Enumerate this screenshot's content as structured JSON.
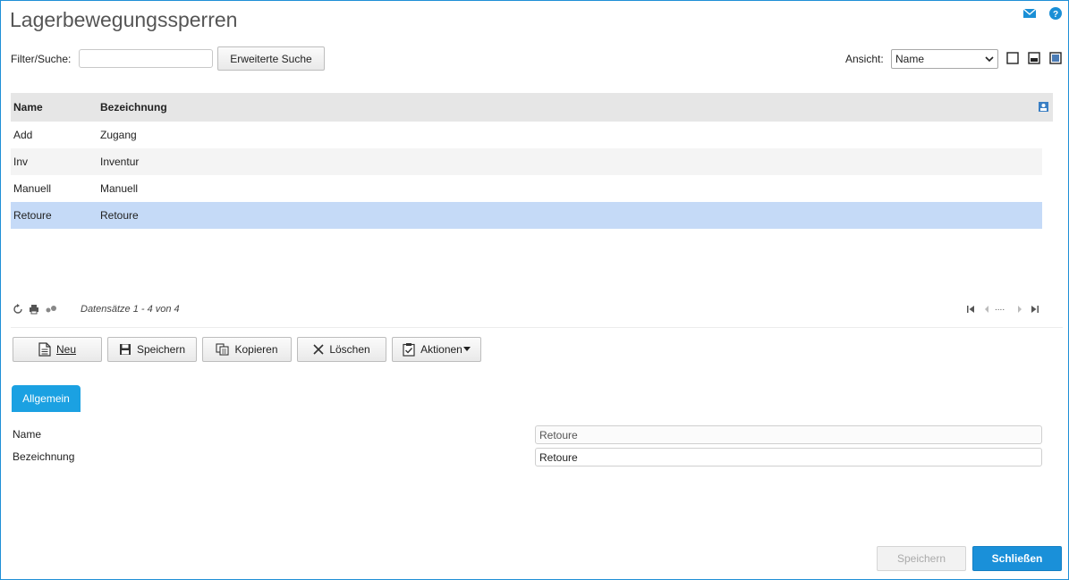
{
  "page": {
    "title": "Lagerbewegungssperren"
  },
  "filter": {
    "label": "Filter/Suche:",
    "value": "",
    "advanced_search_label": "Erweiterte Suche"
  },
  "view": {
    "label": "Ansicht:",
    "selected": "Name"
  },
  "grid": {
    "columns": [
      "Name",
      "Bezeichnung"
    ],
    "rows": [
      {
        "name": "Add",
        "desc": "Zugang"
      },
      {
        "name": "Inv",
        "desc": "Inventur"
      },
      {
        "name": "Manuell",
        "desc": "Manuell"
      },
      {
        "name": "Retoure",
        "desc": "Retoure"
      }
    ],
    "selected_index": 3,
    "record_count": "Datensätze 1 - 4 von 4",
    "pager_middle": "...."
  },
  "toolbar": {
    "new": "Neu",
    "save": "Speichern",
    "copy": "Kopieren",
    "delete": "Löschen",
    "actions": "Aktionen"
  },
  "tabs": {
    "general": "Allgemein"
  },
  "form": {
    "name_label": "Name",
    "name_value": "Retoure",
    "desc_label": "Bezeichnung",
    "desc_value": "Retoure"
  },
  "footer": {
    "save": "Speichern",
    "close": "Schließen"
  },
  "colors": {
    "accent": "#1ba1e2",
    "selection": "#c5daf7",
    "border": "#1f8fd6"
  }
}
